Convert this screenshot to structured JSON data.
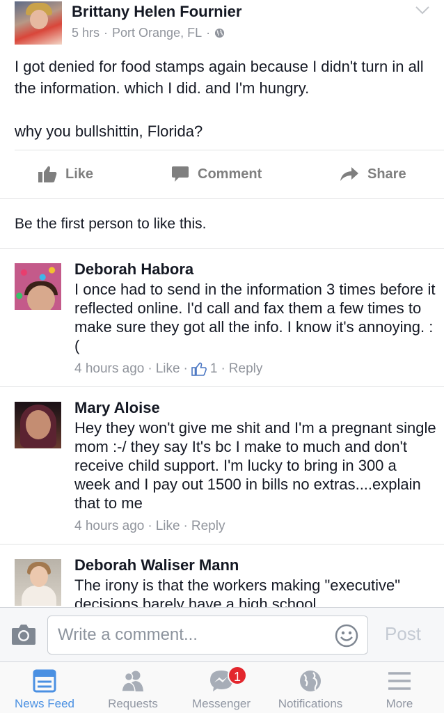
{
  "post": {
    "author": "Brittany Helen Fournier",
    "time": "5 hrs",
    "separator": "·",
    "location": "Port Orange, FL",
    "privacy_icon": "globe-icon",
    "text_p1": "I got denied for food stamps again because I didn't turn in all the information. which I did. and I'm hungry.",
    "text_p2": "why you bullshittin, Florida?"
  },
  "actions": {
    "like": "Like",
    "comment": "Comment",
    "share": "Share"
  },
  "likes_line": "Be the first person to like this.",
  "comments": [
    {
      "name": "Deborah Habora",
      "text": "I once had to send in the information 3 times before it reflected online. I'd call and fax them a few times to make sure they got all the info. I know it's annoying. :(",
      "time": "4 hours ago",
      "like": "Like",
      "like_count": "1",
      "reply": "Reply"
    },
    {
      "name": "Mary Aloise",
      "text": "Hey they won't give me shit and I'm a pregnant single mom :-/ they say It's bc I make to much and don't receive child support.  I'm lucky to bring in 300 a week and I pay out 1500 in bills no extras....explain that to me",
      "time": "4 hours ago",
      "like": "Like",
      "reply": "Reply"
    },
    {
      "name": "Deborah Waliser Mann",
      "text": "The irony is that the workers making \"executive\" decisions barely have a high school"
    }
  ],
  "composer": {
    "placeholder": "Write a comment...",
    "post_label": "Post"
  },
  "tabbar": {
    "active_color": "#4a90e2",
    "tabs": [
      {
        "label": "News Feed",
        "icon": "news-feed-icon"
      },
      {
        "label": "Requests",
        "icon": "friend-requests-icon"
      },
      {
        "label": "Messenger",
        "icon": "messenger-icon",
        "badge": "1"
      },
      {
        "label": "Notifications",
        "icon": "globe-icon"
      },
      {
        "label": "More",
        "icon": "hamburger-menu-icon"
      }
    ]
  }
}
